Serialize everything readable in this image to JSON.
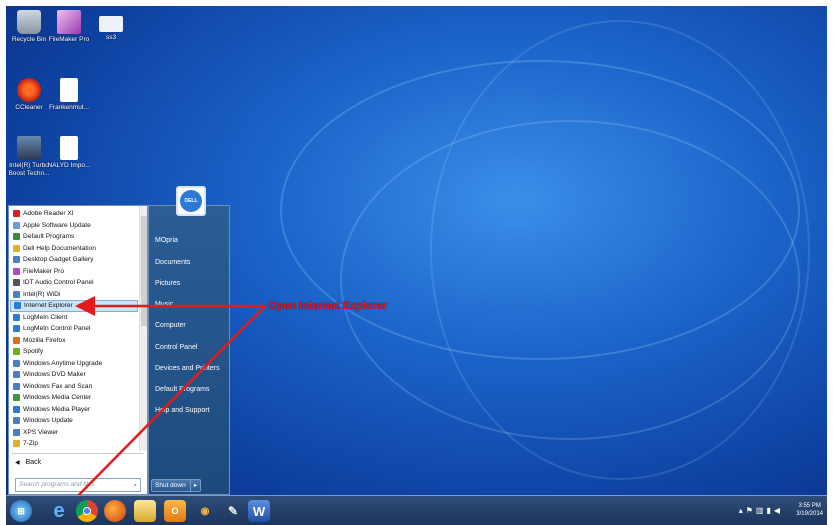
{
  "desktop": {
    "icons": [
      {
        "label": "Recycle Bin",
        "icon": "recycle-bin-icon"
      },
      {
        "label": "FileMaker Pro",
        "icon": "filemaker-icon"
      },
      {
        "label": "ss3",
        "icon": "file-icon"
      },
      {
        "label": "CCleaner",
        "icon": "ccleaner-icon"
      },
      {
        "label": "Frankenmut...",
        "icon": "document-icon"
      },
      {
        "label": "Intel(R) Turbo Boost Techn...",
        "icon": "monitor-icon"
      },
      {
        "label": "NALYD Impo...",
        "icon": "document-icon"
      }
    ]
  },
  "start_menu": {
    "programs": [
      {
        "label": "Adobe Reader XI",
        "color": "#d42020"
      },
      {
        "label": "Apple Software Update",
        "color": "#6b9bd6"
      },
      {
        "label": "Default Programs",
        "color": "#3a8a3a"
      },
      {
        "label": "Dell Help Documentation",
        "color": "#e0b020"
      },
      {
        "label": "Desktop Gadget Gallery",
        "color": "#4a7fc2"
      },
      {
        "label": "FileMaker Pro",
        "color": "#b04ac0"
      },
      {
        "label": "IDT Audio Control Panel",
        "color": "#555555"
      },
      {
        "label": "Intel(R) WiDi",
        "color": "#4a7fc2"
      },
      {
        "label": "Internet Explorer",
        "color": "#2a7ad6"
      },
      {
        "label": "LogMeIn Client",
        "color": "#2a7ad6"
      },
      {
        "label": "LogMeIn Control Panel",
        "color": "#2a7ad6"
      },
      {
        "label": "Mozilla Firefox",
        "color": "#e06a20"
      },
      {
        "label": "Spotify",
        "color": "#6ab020"
      },
      {
        "label": "Windows Anytime Upgrade",
        "color": "#4a7fc2"
      },
      {
        "label": "Windows DVD Maker",
        "color": "#4a7fc2"
      },
      {
        "label": "Windows Fax and Scan",
        "color": "#4a7fc2"
      },
      {
        "label": "Windows Media Center",
        "color": "#3a9a3a"
      },
      {
        "label": "Windows Media Player",
        "color": "#2a7ad6"
      },
      {
        "label": "Windows Update",
        "color": "#4a7fc2"
      },
      {
        "label": "XPS Viewer",
        "color": "#4a7fc2"
      },
      {
        "label": "7-Zip",
        "color": "#e0b020"
      }
    ],
    "selected": "Internet Explorer",
    "back_label": "Back",
    "search_placeholder": "Search programs and files",
    "user_logo": "DELL",
    "right_items": [
      "MOpria",
      "Documents",
      "Pictures",
      "Music",
      "Computer",
      "Control Panel",
      "Devices and Printers",
      "Default Programs",
      "Help and Support"
    ],
    "shutdown_label": "Shut down"
  },
  "annotation": {
    "text": "Open Internet Explorer",
    "color": "#e41b1b"
  },
  "taskbar": {
    "apps": [
      "start-orb",
      "internet-explorer",
      "chrome",
      "firefox",
      "file-explorer",
      "outlook",
      "media-player",
      "paint",
      "word"
    ],
    "clock_time": "3:55 PM",
    "clock_date": "3/19/2014"
  }
}
